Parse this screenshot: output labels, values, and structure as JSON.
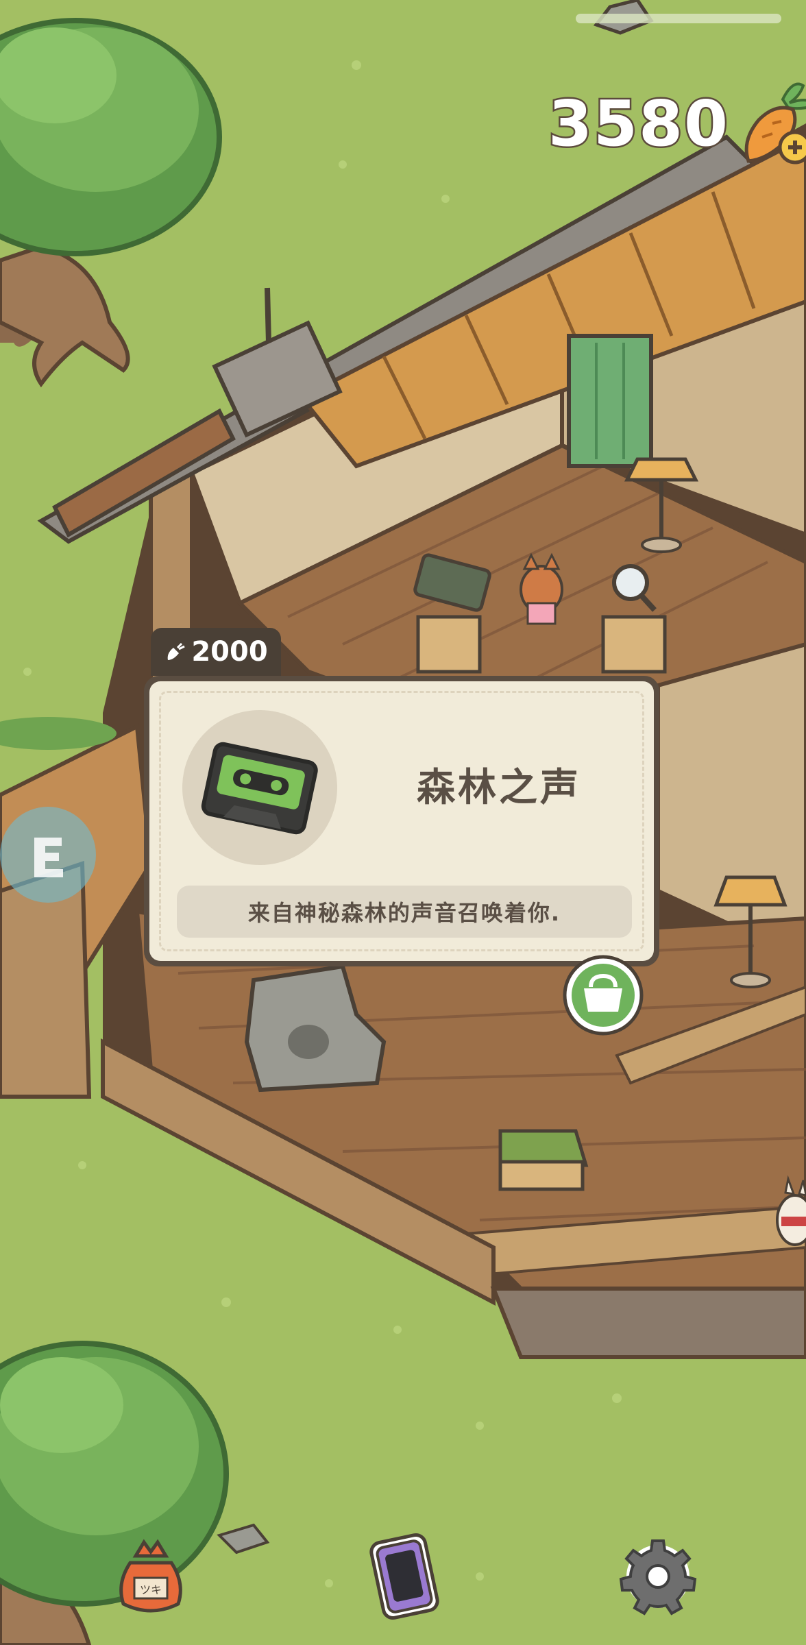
{
  "hud": {
    "carrot_count": "3580",
    "icons": {
      "carrot": "carrot-plus-icon",
      "drag_bar": "drag-bar"
    }
  },
  "shop_card": {
    "price": "2000",
    "price_icon": "carrot-icon",
    "item_name": "森林之声",
    "item_description": "来自神秘森林的声音召唤着你.",
    "item_icon": "cassette-tape-icon"
  },
  "buttons": {
    "buy": "shopping-bag-icon",
    "inventory": "sack-icon",
    "phone": "phone-icon",
    "settings": "gear-icon"
  },
  "bag_label": "ツキ",
  "colors": {
    "grass": "#a3bf63",
    "wood_floor": "#9c6f48",
    "card_bg": "#f1ebd9",
    "card_border": "#5a4d41",
    "accent_green": "#6fb35c"
  }
}
